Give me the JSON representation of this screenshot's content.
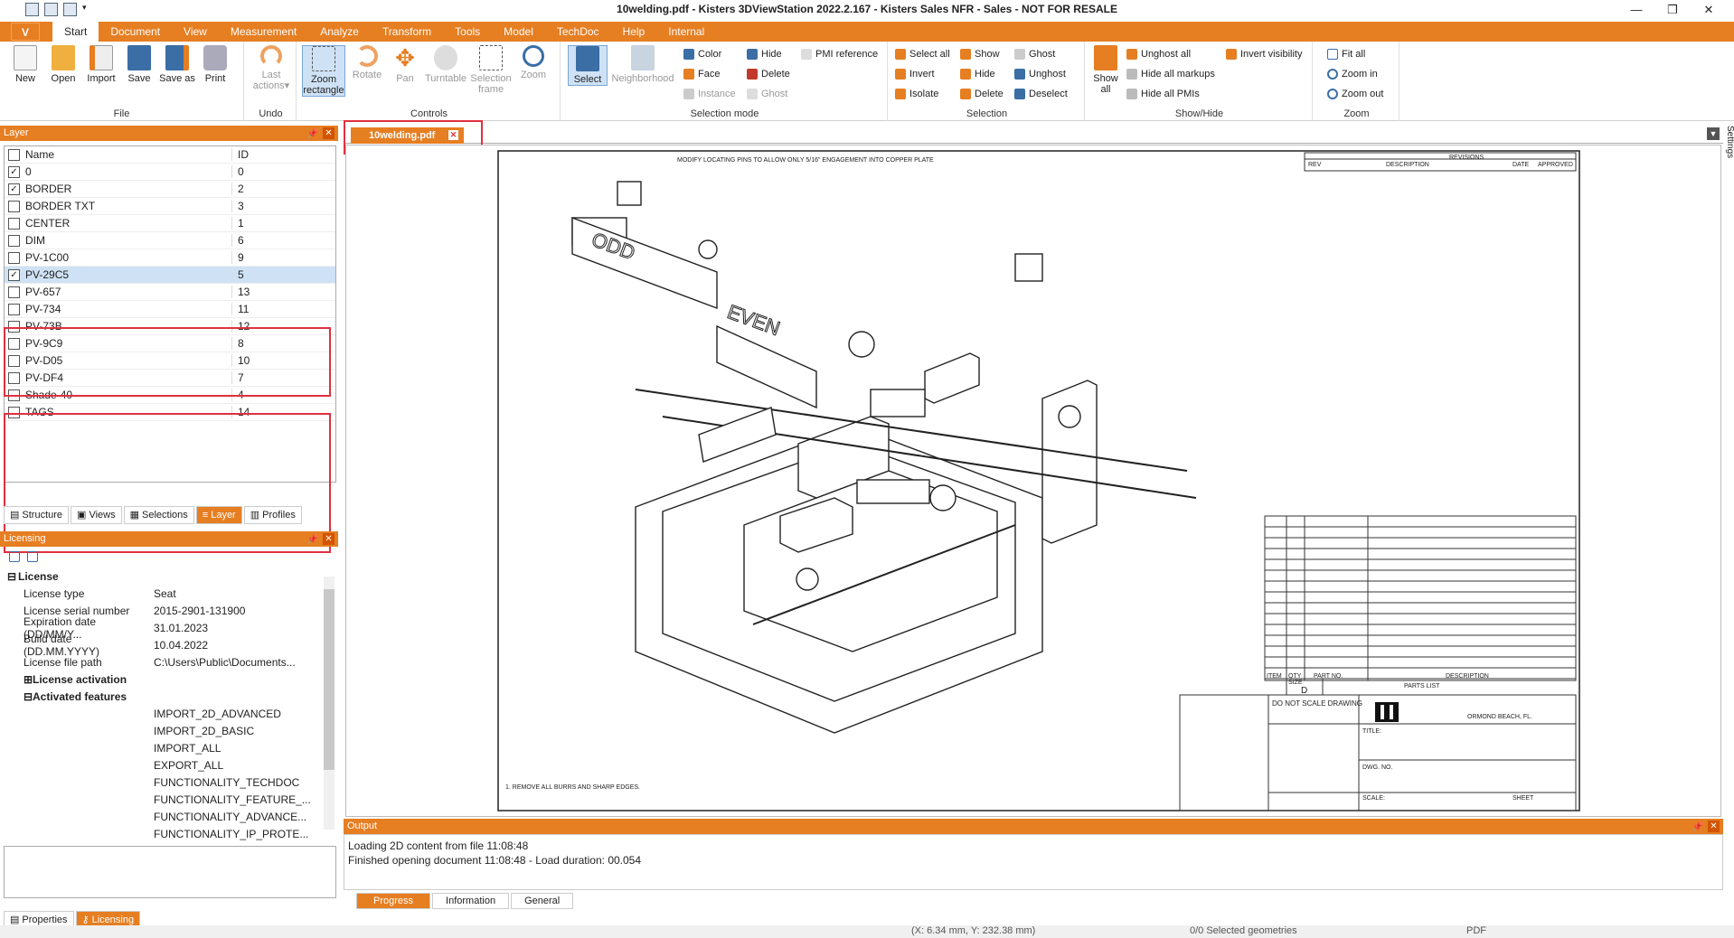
{
  "title": "10welding.pdf - Kisters 3DViewStation 2022.2.167 - Kisters Sales NFR - Sales - NOT FOR RESALE",
  "app_button": "V",
  "menus": [
    "Start",
    "Document",
    "View",
    "Measurement",
    "Analyze",
    "Transform",
    "Tools",
    "Model",
    "TechDoc",
    "Help",
    "Internal"
  ],
  "ribbon": {
    "file": {
      "label": "File",
      "buttons": [
        "New",
        "Open",
        "Import",
        "Save",
        "Save as",
        "Print"
      ]
    },
    "undo": {
      "label": "Undo",
      "button": "Last actions"
    },
    "controls": {
      "label": "Controls",
      "buttons": [
        "Zoom rectangle",
        "Rotate",
        "Pan",
        "Turntable",
        "Selection frame",
        "Zoom"
      ]
    },
    "selection_mode": {
      "label": "Selection mode",
      "select": "Select",
      "neighborhood": "Neighborhood",
      "color": "Color",
      "face": "Face",
      "instance": "Instance",
      "hide": "Hide",
      "delete": "Delete",
      "ghost": "Ghost",
      "pmi": "PMI reference"
    },
    "selection": {
      "label": "Selection",
      "select_all": "Select all",
      "invert": "Invert",
      "isolate": "Isolate",
      "show": "Show",
      "hide": "Hide",
      "delete": "Delete",
      "ghost": "Ghost",
      "unghost": "Unghost",
      "deselect": "Deselect"
    },
    "showhide": {
      "label": "Show/Hide",
      "show_all": "Show all",
      "unghost_all": "Unghost all",
      "hide_all_markups": "Hide all markups",
      "hide_all_pmis": "Hide all PMIs",
      "invert_visibility": "Invert visibility"
    },
    "zoom": {
      "label": "Zoom",
      "fit_all": "Fit all",
      "zoom_in": "Zoom in",
      "zoom_out": "Zoom out"
    }
  },
  "layer_panel": {
    "title": "Layer",
    "col_name": "Name",
    "col_id": "ID",
    "rows": [
      {
        "name": "0",
        "id": "0",
        "checked": true
      },
      {
        "name": "BORDER",
        "id": "2",
        "checked": true
      },
      {
        "name": "BORDER TXT",
        "id": "3",
        "checked": false
      },
      {
        "name": "CENTER",
        "id": "1",
        "checked": false
      },
      {
        "name": "DIM",
        "id": "6",
        "checked": false
      },
      {
        "name": "PV-1C00",
        "id": "9",
        "checked": false
      },
      {
        "name": "PV-29C5",
        "id": "5",
        "checked": true,
        "selected": true
      },
      {
        "name": "PV-657",
        "id": "13",
        "checked": false
      },
      {
        "name": "PV-734",
        "id": "11",
        "checked": false
      },
      {
        "name": "PV-73B",
        "id": "12",
        "checked": false
      },
      {
        "name": "PV-9C9",
        "id": "8",
        "checked": false
      },
      {
        "name": "PV-D05",
        "id": "10",
        "checked": false
      },
      {
        "name": "PV-DF4",
        "id": "7",
        "checked": false
      },
      {
        "name": "Shade-40",
        "id": "4",
        "checked": false
      },
      {
        "name": "TAGS",
        "id": "14",
        "checked": false
      }
    ],
    "tabs": [
      "Structure",
      "Views",
      "Selections",
      "Layer",
      "Profiles"
    ],
    "active_tab": "Layer"
  },
  "licensing": {
    "title": "Licensing",
    "section": "License",
    "rows": [
      {
        "k": "License type",
        "v": "Seat"
      },
      {
        "k": "License serial number",
        "v": "2015-2901-131900"
      },
      {
        "k": "Expiration date (DD/MM/Y...",
        "v": "31.01.2023"
      },
      {
        "k": "Build date (DD.MM.YYYY)",
        "v": "10.04.2022"
      },
      {
        "k": "License file path",
        "v": "C:\\Users\\Public\\Documents..."
      }
    ],
    "activation": "License activation",
    "features_hdr": "Activated features",
    "features": [
      "IMPORT_2D_ADVANCED",
      "IMPORT_2D_BASIC",
      "IMPORT_ALL",
      "EXPORT_ALL",
      "FUNCTIONALITY_TECHDOC",
      "FUNCTIONALITY_FEATURE_...",
      "FUNCTIONALITY_ADVANCE...",
      "FUNCTIONALITY_IP_PROTE..."
    ],
    "tabs": [
      "Properties",
      "Licensing"
    ]
  },
  "doc_tab": "10welding.pdf",
  "settings_label": "Settings",
  "drawing": {
    "note": "MODIFY LOCATING PINS TO ALLOW ONLY 5/16\" ENGAGEMENT INTO COPPER PLATE",
    "odd": "ODD",
    "even": "EVEN",
    "revisions": "REVISIONS",
    "rev": "REV",
    "description": "DESCRIPTION",
    "date": "DATE",
    "approved": "APPROVED",
    "parts_list": "PARTS LIST",
    "item": "ITEM",
    "qty": "QTY",
    "part_no": "PART NO.",
    "notes": "1. REMOVE ALL BURRS AND SHARP EDGES.",
    "dns": "DO NOT SCALE DRAWING",
    "company": "ORMOND BEACH, FL.",
    "size": "SIZE",
    "size_val": "D",
    "title_lbl": "TITLE:",
    "dwg": "DWG. NO.",
    "scale": "SCALE:",
    "sheet": "SHEET"
  },
  "output": {
    "title": "Output",
    "lines": [
      "Loading 2D content from file 11:08:48",
      "Finished opening document 11:08:48 - Load duration: 00.054"
    ],
    "tabs": [
      "Progress",
      "Information",
      "General"
    ]
  },
  "status": {
    "coords": "(X: 6.34 mm, Y: 232.38 mm)",
    "selected": "0/0 Selected geometries",
    "format": "PDF"
  },
  "colors": {
    "accent": "#e67e22",
    "highlight": "#e03040"
  }
}
